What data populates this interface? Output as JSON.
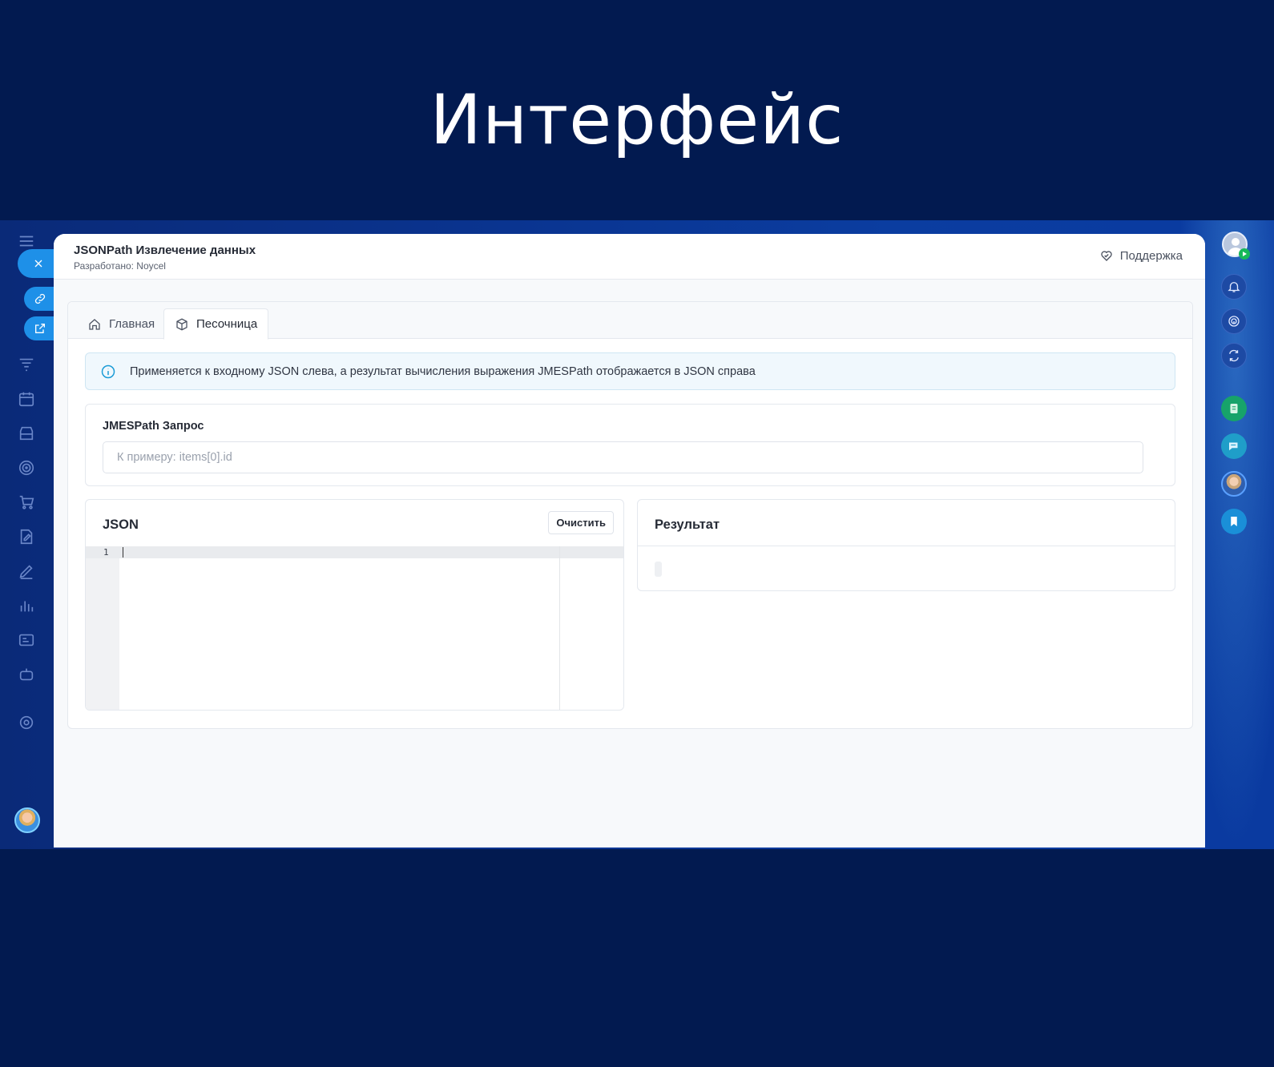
{
  "hero": {
    "title": "Интерфейс"
  },
  "app": {
    "name": "JSONPath Извлечение данных",
    "developer": "Разработано: Noycel",
    "support_label": "Поддержка"
  },
  "tabs": [
    {
      "label": "Главная",
      "icon": "home-icon",
      "active": false
    },
    {
      "label": "Песочница",
      "icon": "box-icon",
      "active": true
    }
  ],
  "info": {
    "text": "Применяется к входному JSON слева, а результат вычисления выражения JMESPath отображается в JSON справа"
  },
  "query": {
    "label": "JMESPath Запрос",
    "placeholder": "К примеру: items[0].id",
    "value": ""
  },
  "json_panel": {
    "title": "JSON",
    "clear_label": "Очистить",
    "line_numbers": [
      "1"
    ]
  },
  "result_panel": {
    "title": "Результат"
  },
  "colors": {
    "accent": "#1e90e8",
    "background": "#021a50",
    "info": "#1a9bd6",
    "badge_green": "#17b85a"
  },
  "left_rail_icons": [
    "menu-icon",
    "close-icon",
    "link-icon",
    "external-link-icon",
    "filter-icon",
    "calendar-icon",
    "archive-icon",
    "target-icon",
    "cart-icon",
    "edit-doc-icon",
    "pen-icon",
    "chart-icon",
    "id-card-icon",
    "robot-icon",
    "settings-icon"
  ],
  "right_rail_icons": [
    "bell-icon",
    "fingerprint-icon",
    "sync-icon",
    "notes-app-icon",
    "chat-app-icon",
    "assistant-avatar",
    "bookmark-app-icon"
  ]
}
